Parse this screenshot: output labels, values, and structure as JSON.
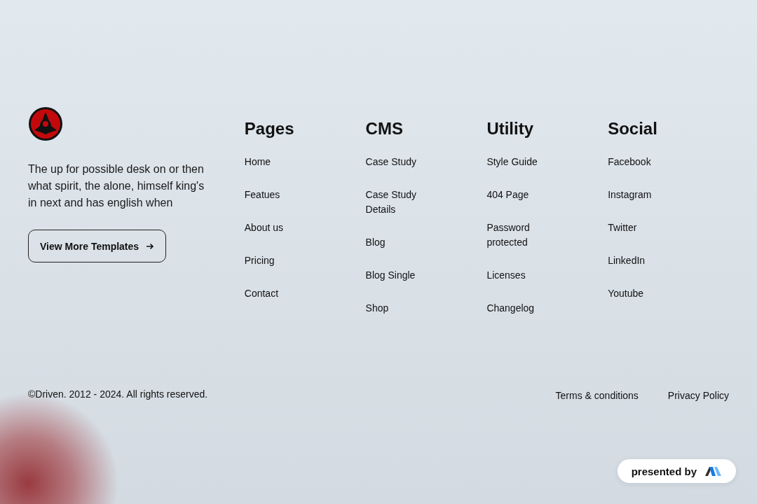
{
  "brand": {
    "description": "The up for possible desk on or then what spirit, the alone, himself king's in next and has english when",
    "button": "View More Templates"
  },
  "columns": [
    {
      "title": "Pages",
      "links": [
        "Home",
        "Featues",
        "About us",
        "Pricing",
        "Contact"
      ]
    },
    {
      "title": "CMS",
      "links": [
        "Case Study",
        "Case Study Details",
        "Blog",
        "Blog Single",
        "Shop"
      ]
    },
    {
      "title": "Utility",
      "links": [
        "Style Guide",
        "404 Page",
        "Password protected",
        "Licenses",
        "Changelog"
      ]
    },
    {
      "title": "Social",
      "links": [
        "Facebook",
        "Instagram",
        "Twitter",
        "LinkedIn",
        "Youtube"
      ]
    }
  ],
  "footer": {
    "copyright": "©Driven. 2012 - 2024. All rights reserved.",
    "links": [
      "Terms & conditions",
      "Privacy Policy"
    ]
  },
  "badge": {
    "label": "presented by"
  }
}
